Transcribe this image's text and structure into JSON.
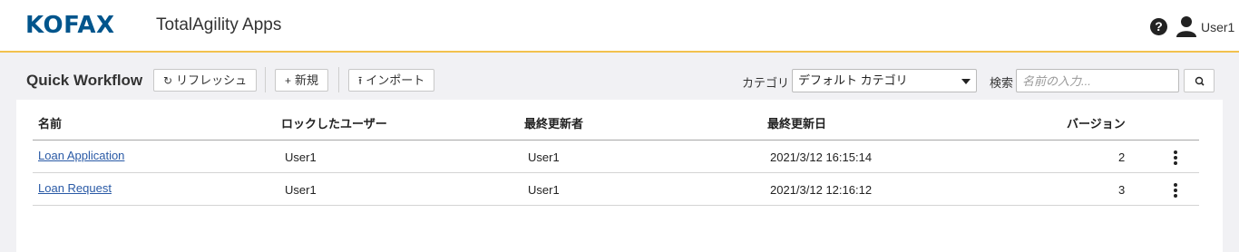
{
  "header": {
    "logo_text": "KOFAX",
    "app_title": "TotalAgility Apps",
    "help_icon": "question-circle-icon",
    "user_icon": "user-icon",
    "user_name": "User1",
    "accent_color": "#f2c14e",
    "brand_color": "#00558c"
  },
  "toolbar": {
    "page_title": "Quick Workflow",
    "refresh_label": "リフレッシュ",
    "new_label": "新規",
    "import_label": "インポート",
    "category_label": "カテゴリ",
    "category_value": "デフォルト カテゴリ",
    "search_label": "検索",
    "search_placeholder": "名前の入力..."
  },
  "table": {
    "columns": [
      "名前",
      "ロックしたユーザー",
      "最終更新者",
      "最終更新日",
      "バージョン"
    ],
    "rows": [
      {
        "name": "Loan Application",
        "locked_by": "User1",
        "modified_by": "User1",
        "modified_date": "2021/3/12 16:15:14",
        "version": "2"
      },
      {
        "name": "Loan Request",
        "locked_by": "User1",
        "modified_by": "User1",
        "modified_date": "2021/3/12 12:16:12",
        "version": "3"
      }
    ]
  }
}
